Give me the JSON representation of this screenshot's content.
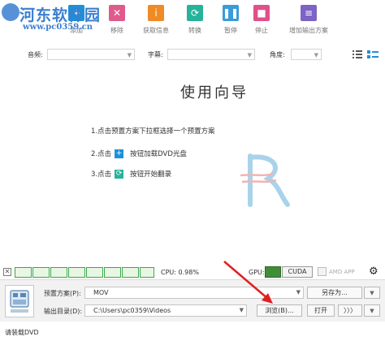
{
  "watermark": {
    "title": "河东软件园",
    "url": "www.pc0359.cn"
  },
  "toolbar": {
    "items": [
      {
        "label": "添加",
        "icon": "plus-icon",
        "color": "#1e90d6"
      },
      {
        "label": "移除",
        "icon": "x-icon",
        "color": "#e05a8c"
      },
      {
        "label": "获取信息",
        "icon": "info-icon",
        "color": "#f08a24"
      },
      {
        "label": "转换",
        "icon": "refresh-icon",
        "color": "#25b39a"
      },
      {
        "label": "暂停",
        "icon": "pause-icon",
        "color": "#3a9bd9"
      },
      {
        "label": "停止",
        "icon": "stop-icon",
        "color": "#e0508a"
      },
      {
        "label": "增加输出方案",
        "icon": "file-add-icon",
        "color": "#7d63c5"
      }
    ]
  },
  "options": {
    "audio_label": "音频:",
    "subtitle_label": "字幕:",
    "angle_label": "角度:"
  },
  "guide": {
    "title": "使用向导",
    "step1": "1.点击预置方案下拉框选择一个预置方案",
    "step2_prefix": "2.点击",
    "step2_suffix": "按钮加载DVD光盘",
    "step3_prefix": "3.点击",
    "step3_suffix": "按钮开始翻录"
  },
  "status_strip": {
    "cpu_text": "CPU: 0.98%",
    "gpu_label": "GPU:",
    "cuda_label": "CUDA",
    "amd_label": "AMD APP"
  },
  "bottom": {
    "preset_label": "预置方案(P):",
    "preset_value": "MOV",
    "save_as_label": "另存为...",
    "output_label": "输出目录(D):",
    "output_value": "C:\\Users\\pc0359\\Videos",
    "browse_label": "浏览(B)...",
    "open_label": "打开",
    "more_label": "〉〉〉"
  },
  "statusbar": {
    "text": "请装载DVD"
  },
  "colors": {
    "accent_blue": "#1e90d6",
    "annotation_red": "#e02020",
    "gpu_green": "#3f8d38"
  }
}
